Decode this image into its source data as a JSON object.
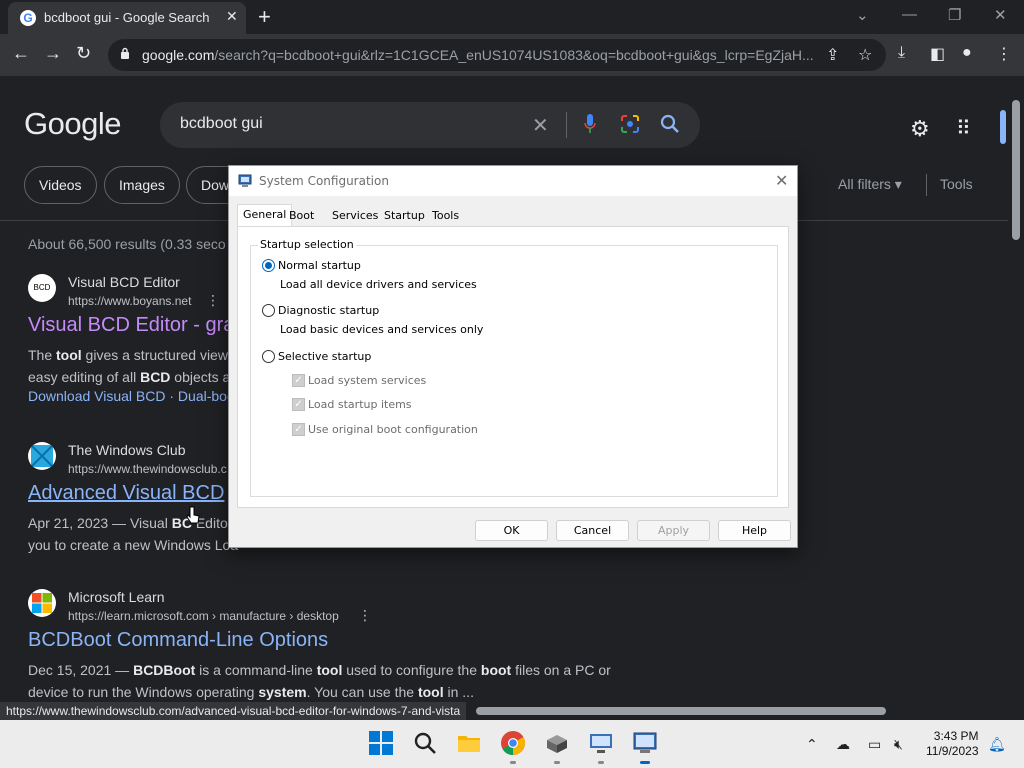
{
  "browser": {
    "tab_title": "bcdboot gui - Google Search",
    "tab_close": "✕",
    "new_tab": "+",
    "url_domain": "google.com",
    "url_path": "/search?q=bcdboot+gui&rlz=1C1GCEA_enUS1074US1083&oq=bcdboot+gui&gs_lcrp=EgZjaH...",
    "hover_url": "https://www.thewindowsclub.com/advanced-visual-bcd-editor-for-windows-7-and-vista"
  },
  "google": {
    "logo": "Google",
    "query": "bcdboot gui",
    "chips": [
      "Videos",
      "Images",
      "Dow"
    ],
    "all_filters": "All filters ▾",
    "tools": "Tools",
    "stats": "About 66,500 results (0.33 seco"
  },
  "results": [
    {
      "site": "Visual BCD Editor",
      "cite": "https://www.boyans.net",
      "favicon_text": "BCD",
      "title": "Visual BCD Editor - gra",
      "snippet_parts": [
        "The ",
        "tool",
        " gives a structured view",
        "easy editing of all ",
        "BCD",
        " objects a"
      ],
      "links": "Download Visual BCD · Dual-boo"
    },
    {
      "site": "The Windows Club",
      "cite": "https://www.thewindowsclub.c",
      "title": "Advanced Visual BCD",
      "snippet_date": "Apr 21, 2023",
      "snippet_parts": [
        " — Visual ",
        "BC",
        " Edito",
        "you to create a new Windows Loa"
      ]
    },
    {
      "site": "Microsoft Learn",
      "cite": "https://learn.microsoft.com › manufacture › desktop",
      "title": "BCDBoot Command-Line Options",
      "snippet_date": "Dec 15, 2021",
      "snippet_parts": [
        " — ",
        "BCDBoot",
        " is a command-line ",
        "tool",
        " used to configure the ",
        "boot",
        " files on a PC or",
        "device to run the Windows operating ",
        "system",
        ". You can use the ",
        "tool",
        " in ..."
      ]
    }
  ],
  "dialog": {
    "title": "System Configuration",
    "close": "✕",
    "tabs": [
      "General",
      "Boot",
      "Services",
      "Startup",
      "Tools"
    ],
    "active_tab": "General",
    "group_label": "Startup selection",
    "options": [
      {
        "label": "Normal startup",
        "desc": "Load all device drivers and services",
        "selected": true
      },
      {
        "label": "Diagnostic startup",
        "desc": "Load basic devices and services only",
        "selected": false
      },
      {
        "label": "Selective startup",
        "desc": "",
        "selected": false
      }
    ],
    "checkboxes": [
      "Load system services",
      "Load startup items",
      "Use original boot configuration"
    ],
    "buttons": {
      "ok": "OK",
      "cancel": "Cancel",
      "apply": "Apply",
      "help": "Help"
    }
  },
  "taskbar": {
    "time": "3:43 PM",
    "date": "11/9/2023"
  },
  "colors": {
    "visited_link": "#c58af9",
    "link": "#8ab4f8",
    "accent": "#0067c0"
  }
}
